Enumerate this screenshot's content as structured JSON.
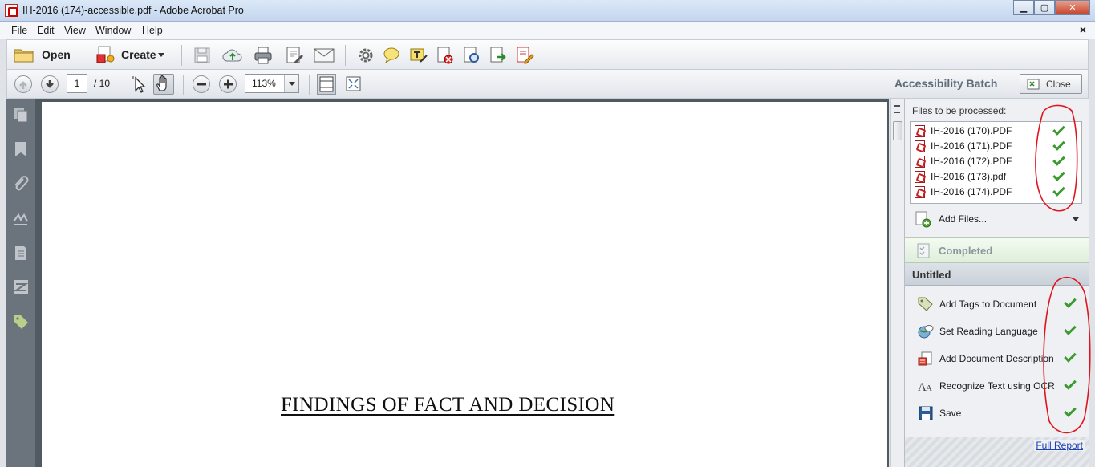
{
  "window": {
    "title": "IH-2016 (174)-accessible.pdf - Adobe Acrobat Pro",
    "minimize": "▁",
    "maximize": "▢",
    "close": "✕"
  },
  "menu": {
    "items": [
      "File",
      "Edit",
      "View",
      "Window",
      "Help"
    ],
    "doc_close": "×"
  },
  "toolbar": {
    "open_label": "Open",
    "create_label": "Create"
  },
  "navbar": {
    "page_number": "1",
    "page_total": "/ 10",
    "zoom": "113%"
  },
  "panel": {
    "title": "Accessibility Batch",
    "close_label": "Close",
    "files_label": "Files to be processed:",
    "files": [
      {
        "name": "IH-2016 (170).PDF",
        "done": true
      },
      {
        "name": "IH-2016 (171).PDF",
        "done": true
      },
      {
        "name": "IH-2016 (172).PDF",
        "done": true
      },
      {
        "name": "IH-2016 (173).pdf",
        "done": true
      },
      {
        "name": "IH-2016 (174).PDF",
        "done": true
      }
    ],
    "add_files_label": "Add Files...",
    "status_label": "Completed",
    "sequence_name": "Untitled",
    "steps": [
      {
        "label": "Add Tags to Document",
        "icon": "tag-icon",
        "done": true
      },
      {
        "label": "Set Reading Language",
        "icon": "globe-icon",
        "done": true
      },
      {
        "label": "Add Document Description",
        "icon": "document-description-icon",
        "done": true
      },
      {
        "label": "Recognize Text using OCR",
        "icon": "ocr-text-icon",
        "done": true
      },
      {
        "label": "Save",
        "icon": "save-icon",
        "done": true
      }
    ],
    "report_link": "Full Report"
  },
  "document": {
    "heading": "FINDINGS OF FACT AND DECISION"
  },
  "colors": {
    "check": "#3c9a2e",
    "annotation": "#e0141e",
    "link": "#1b3fb5"
  }
}
